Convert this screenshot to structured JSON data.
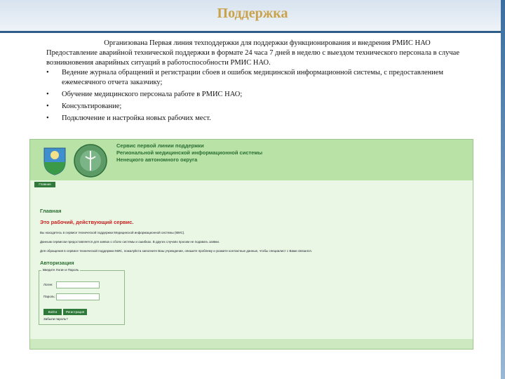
{
  "slide": {
    "title": "Поддержка",
    "intro": "Организована Первая линия техподдержки для поддержки функционирования и внедрения РМИС НАО",
    "paragraph": "Предоставление аварийной технической поддержки в формате 24 часа 7 дней в неделю с выездом технического персонала в случае возникновения аварийных ситуаций в работоспособности РМИС НАО.",
    "bullets": [
      "Ведение журнала обращений и регистрации сбоев и ошибок медицинской информационной системы, с предоставлением ежемесячного отчета заказчику;",
      "Обучение медицинского персонала работе в РМИС НАО;",
      "Консультирование;",
      "Подключение и настройка новых рабочих мест."
    ]
  },
  "shot": {
    "header_title_lines": [
      "Сервис первой линии поддержки",
      "Региональной медицинской информационной системы",
      "Ненецкого автономного округа"
    ],
    "nav_button": "Главная",
    "h_main": "Главная",
    "working": "Это рабочий, действующий сервис.",
    "paragraphs": [
      "Вы находитесь в сервисе технической поддержки Медицинской информационной системы (МИС).",
      "Данным сервисом предоставляется для заявок о сбоях системы и ошибках. В других случаях просим не подавать заявки.",
      "Для обращения в сервисе технической поддержки МИС, пожалуйста заполните Ваш учреждение, опишите проблему и укажите контактные данные, чтобы специалист с Вами связался."
    ],
    "h_auth": "Авторизация",
    "legend": "Введите Логин и Пароль",
    "login_label": "Логин:",
    "password_label": "Пароль:",
    "login_button": "Войти",
    "register_button": "Регистрация",
    "forgot_link": "Забыли пароль?"
  },
  "colors": {
    "title": "#c9a24a",
    "header_green": "#b9e3a6",
    "accent_green": "#2a6e33",
    "red": "#cc1f1f"
  }
}
